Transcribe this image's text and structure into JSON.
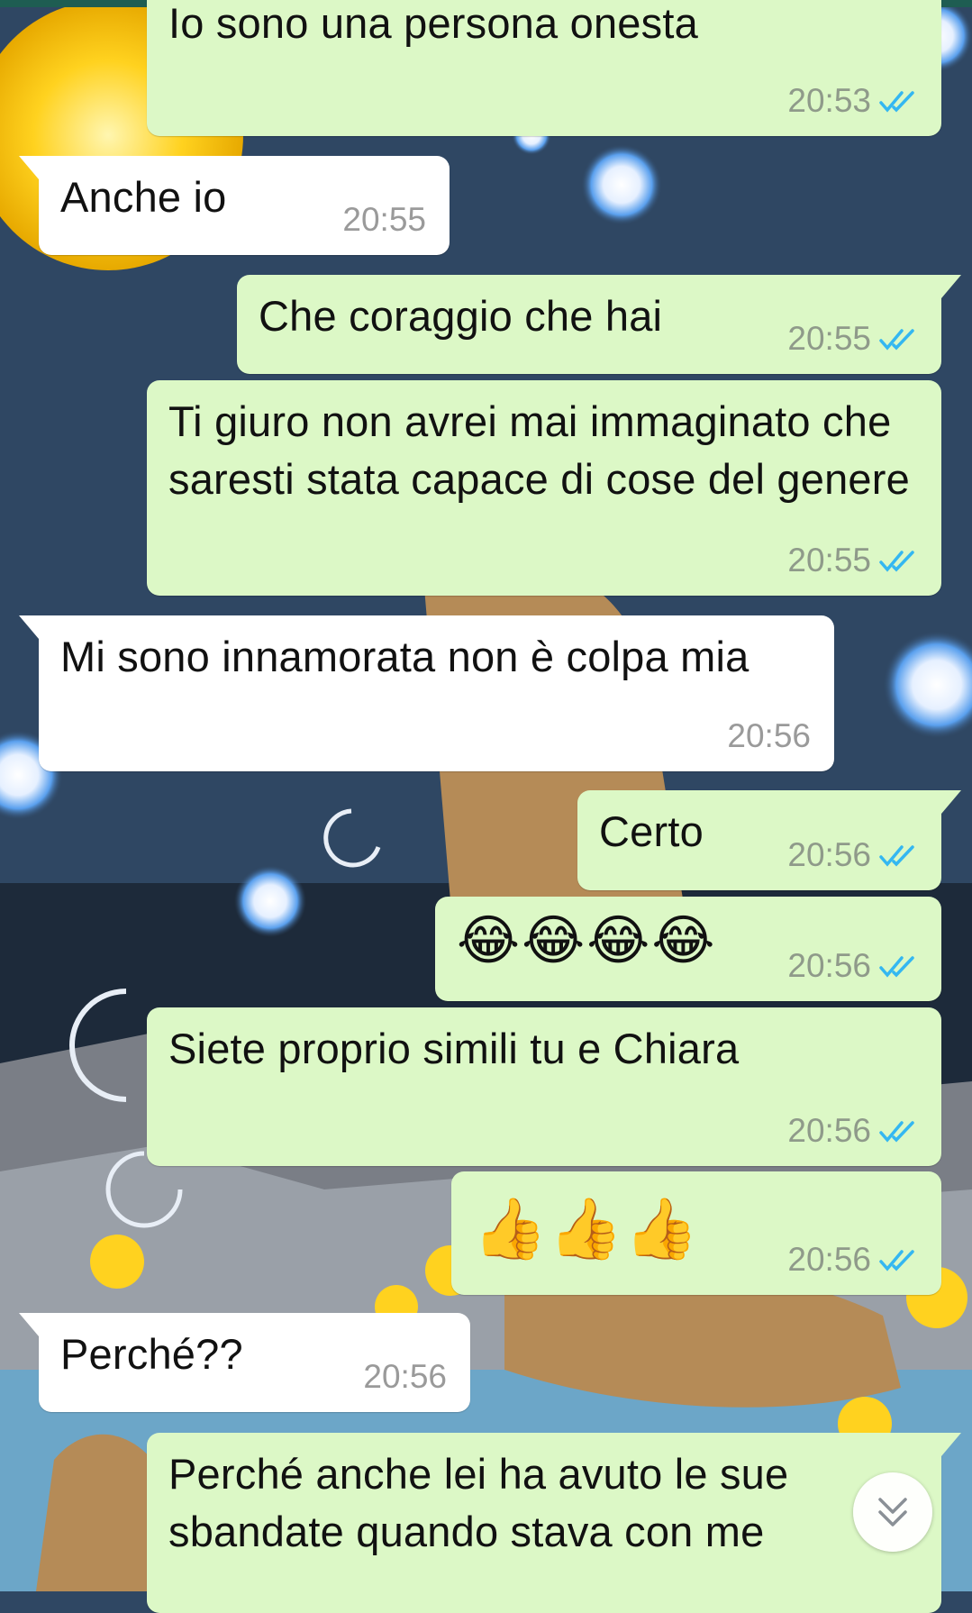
{
  "colors": {
    "outgoing_bubble": "#dcf8c6",
    "incoming_bubble": "#ffffff",
    "read_ticks": "#34b7f1",
    "timestamp": "#8f9a8a"
  },
  "messages": [
    {
      "direction": "out",
      "text": "Io sono una persona onesta",
      "time": "20:53",
      "status": "read"
    },
    {
      "direction": "in",
      "text": "Anche io",
      "time": "20:55"
    },
    {
      "direction": "out",
      "text": "Che coraggio che hai",
      "time": "20:55",
      "status": "read"
    },
    {
      "direction": "out",
      "text": "Ti giuro non avrei mai immaginato che saresti stata capace di cose del genere",
      "time": "20:55",
      "status": "read"
    },
    {
      "direction": "in",
      "text": "Mi sono innamorata non è colpa mia",
      "time": "20:56"
    },
    {
      "direction": "out",
      "text": "Certo",
      "time": "20:56",
      "status": "read"
    },
    {
      "direction": "out",
      "text": "😂😂😂😂",
      "time": "20:56",
      "status": "read"
    },
    {
      "direction": "out",
      "text": "Siete proprio simili tu e Chiara",
      "time": "20:56",
      "status": "read"
    },
    {
      "direction": "out",
      "text": "👍👍👍",
      "time": "20:56",
      "status": "read"
    },
    {
      "direction": "in",
      "text": "Perché??",
      "time": "20:56"
    },
    {
      "direction": "out",
      "text": "Perché anche lei ha avuto le sue sbandate quando stava con me",
      "time": "",
      "status": ""
    }
  ],
  "icons": {
    "read_receipt": "double-check-icon",
    "scroll_down": "chevron-double-down-icon"
  }
}
